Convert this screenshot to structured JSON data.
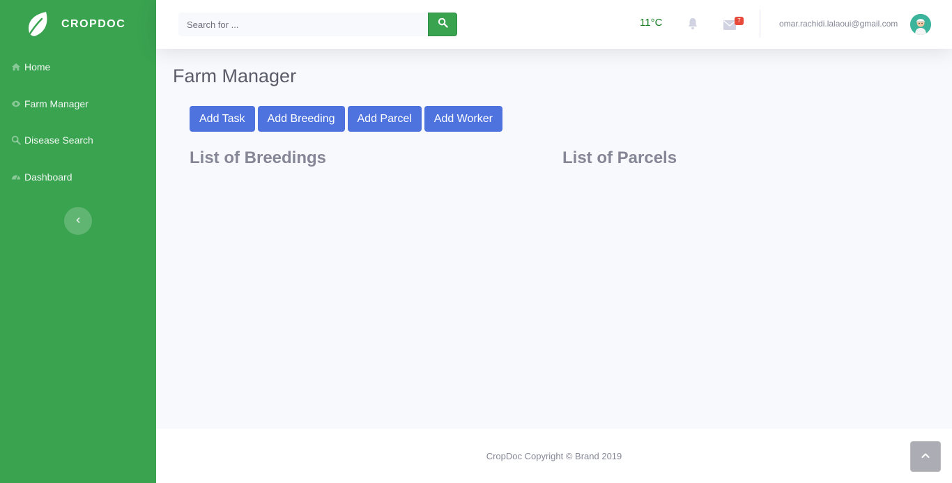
{
  "brand": {
    "name": "CROPDOC",
    "logo_icon": "leaf-icon"
  },
  "sidebar": {
    "items": [
      {
        "label": "Home",
        "icon": "home-icon"
      },
      {
        "label": "Farm Manager",
        "icon": "eye-icon"
      },
      {
        "label": "Disease Search",
        "icon": "search-icon"
      },
      {
        "label": "Dashboard",
        "icon": "tachometer-icon"
      }
    ],
    "toggle_icon": "chevron-left-icon"
  },
  "topbar": {
    "search_placeholder": "Search for ...",
    "temperature": "11°C",
    "messages_count": "7",
    "user_email": "omar.rachidi.lalaoui@gmail.com"
  },
  "main": {
    "title": "Farm Manager",
    "buttons": [
      "Add Task",
      "Add Breeding",
      "Add Parcel",
      "Add Worker"
    ],
    "breedings_title": "List of Breedings",
    "parcels_title": "List of Parcels"
  },
  "footer": {
    "text": "CropDoc Copyright © Brand 2019"
  },
  "colors": {
    "sidebar": "#39a350",
    "primary": "#4e73df",
    "temperature": "#137a1f",
    "badge": "#e74a3b"
  }
}
